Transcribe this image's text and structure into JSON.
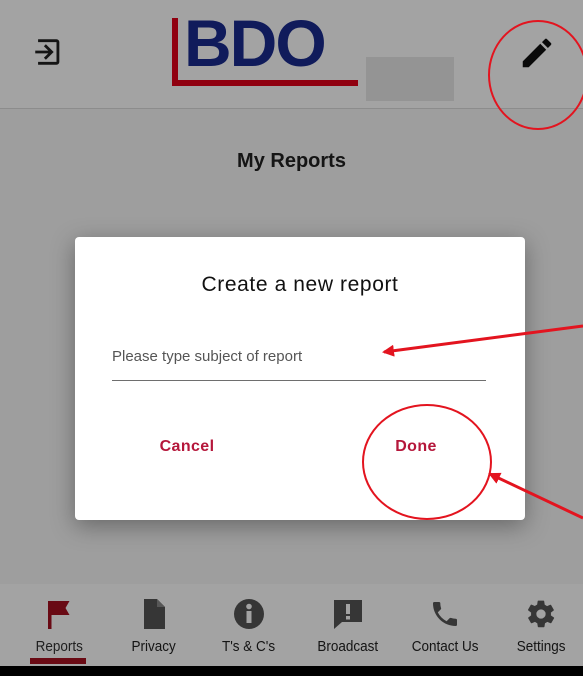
{
  "app": {
    "logo_text": "BDO",
    "page_title": "My Reports",
    "header_icons": [
      "logout-icon",
      "edit-pencil-icon"
    ]
  },
  "dialog": {
    "title": "Create a new report",
    "input_placeholder": "Please type subject of report",
    "input_value": "",
    "cancel_label": "Cancel",
    "done_label": "Done"
  },
  "tabs": [
    {
      "label": "Reports",
      "icon": "flag-icon",
      "active": true
    },
    {
      "label": "Privacy",
      "icon": "document-icon",
      "active": false
    },
    {
      "label": "T's & C's",
      "icon": "info-icon",
      "active": false
    },
    {
      "label": "Broadcast",
      "icon": "message-alert-icon",
      "active": false
    },
    {
      "label": "Contact Us",
      "icon": "phone-icon",
      "active": false
    },
    {
      "label": "Settings",
      "icon": "gear-icon",
      "active": false
    }
  ],
  "colors": {
    "accent": "#a51020",
    "button_text": "#b5173b",
    "logo_blue": "#1a2b8f",
    "logo_red": "#e1001a",
    "annotation_red": "#e3141f"
  }
}
